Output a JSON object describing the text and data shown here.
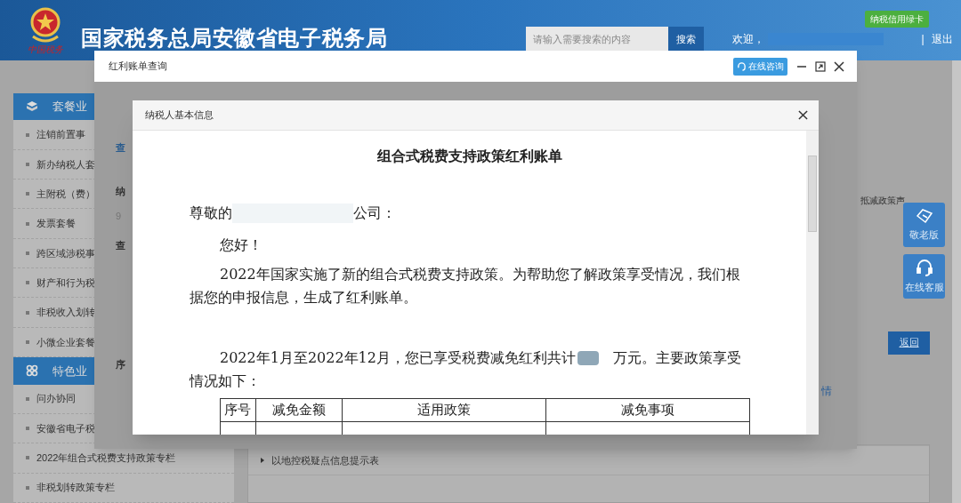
{
  "header": {
    "logo_text": "中国税务",
    "site_title": "国家税务总局安徽省电子税务局",
    "search": {
      "placeholder": "请输入需要搜索的内容",
      "button": "搜索"
    },
    "welcome": "欢迎，",
    "separator": "|",
    "logout": "退出",
    "badge": "纳税信用绿卡"
  },
  "sidebar": {
    "sections": [
      {
        "title": "套餐业",
        "kind": "cube",
        "items": [
          "注销前置事",
          "新办纳税人套",
          "主附税（费）",
          "发票套餐",
          "跨区域涉税事",
          "财产和行为税",
          "非税收入划转",
          "小微企业套餐"
        ]
      },
      {
        "title": "特色业",
        "kind": "grid",
        "items": [
          "问办协同",
          "安徽省电子税",
          "2022年组合式税费支持政策专栏",
          "非税划转政策专栏"
        ]
      }
    ]
  },
  "main": {
    "policy_text": "抵减政策声",
    "back_button": "返回",
    "list_row": "以地控税疑点信息提示表"
  },
  "float_buttons": [
    {
      "label": "敬老版",
      "kind": "handshake"
    },
    {
      "label": "在线客服",
      "kind": "headset"
    }
  ],
  "bill_dialog": {
    "title": "红利账单查询",
    "consult_button": "在线咨询",
    "form_fragments": [
      "查",
      "纳",
      "9",
      "查",
      "序"
    ],
    "right_fragment": "情"
  },
  "info_dialog": {
    "title": "纳税人基本信息",
    "document": {
      "title": "组合式税费支持政策红利账单",
      "salutation_prefix": "尊敬的",
      "salutation_suffix": "公司：",
      "greeting": "您好！",
      "paragraph": "2022年国家实施了新的组合式税费支持政策。为帮助您了解政策享受情况，我们根据您的申报信息，生成了红利账单。",
      "summary_parts": [
        "2022年1月至2022年12月，您已享受税费减免红利共计",
        "万元。主要政策享受",
        "情况如下："
      ],
      "table": {
        "columns": [
          "序号",
          "减免金额",
          "适用政策",
          "减免事项"
        ]
      }
    }
  }
}
